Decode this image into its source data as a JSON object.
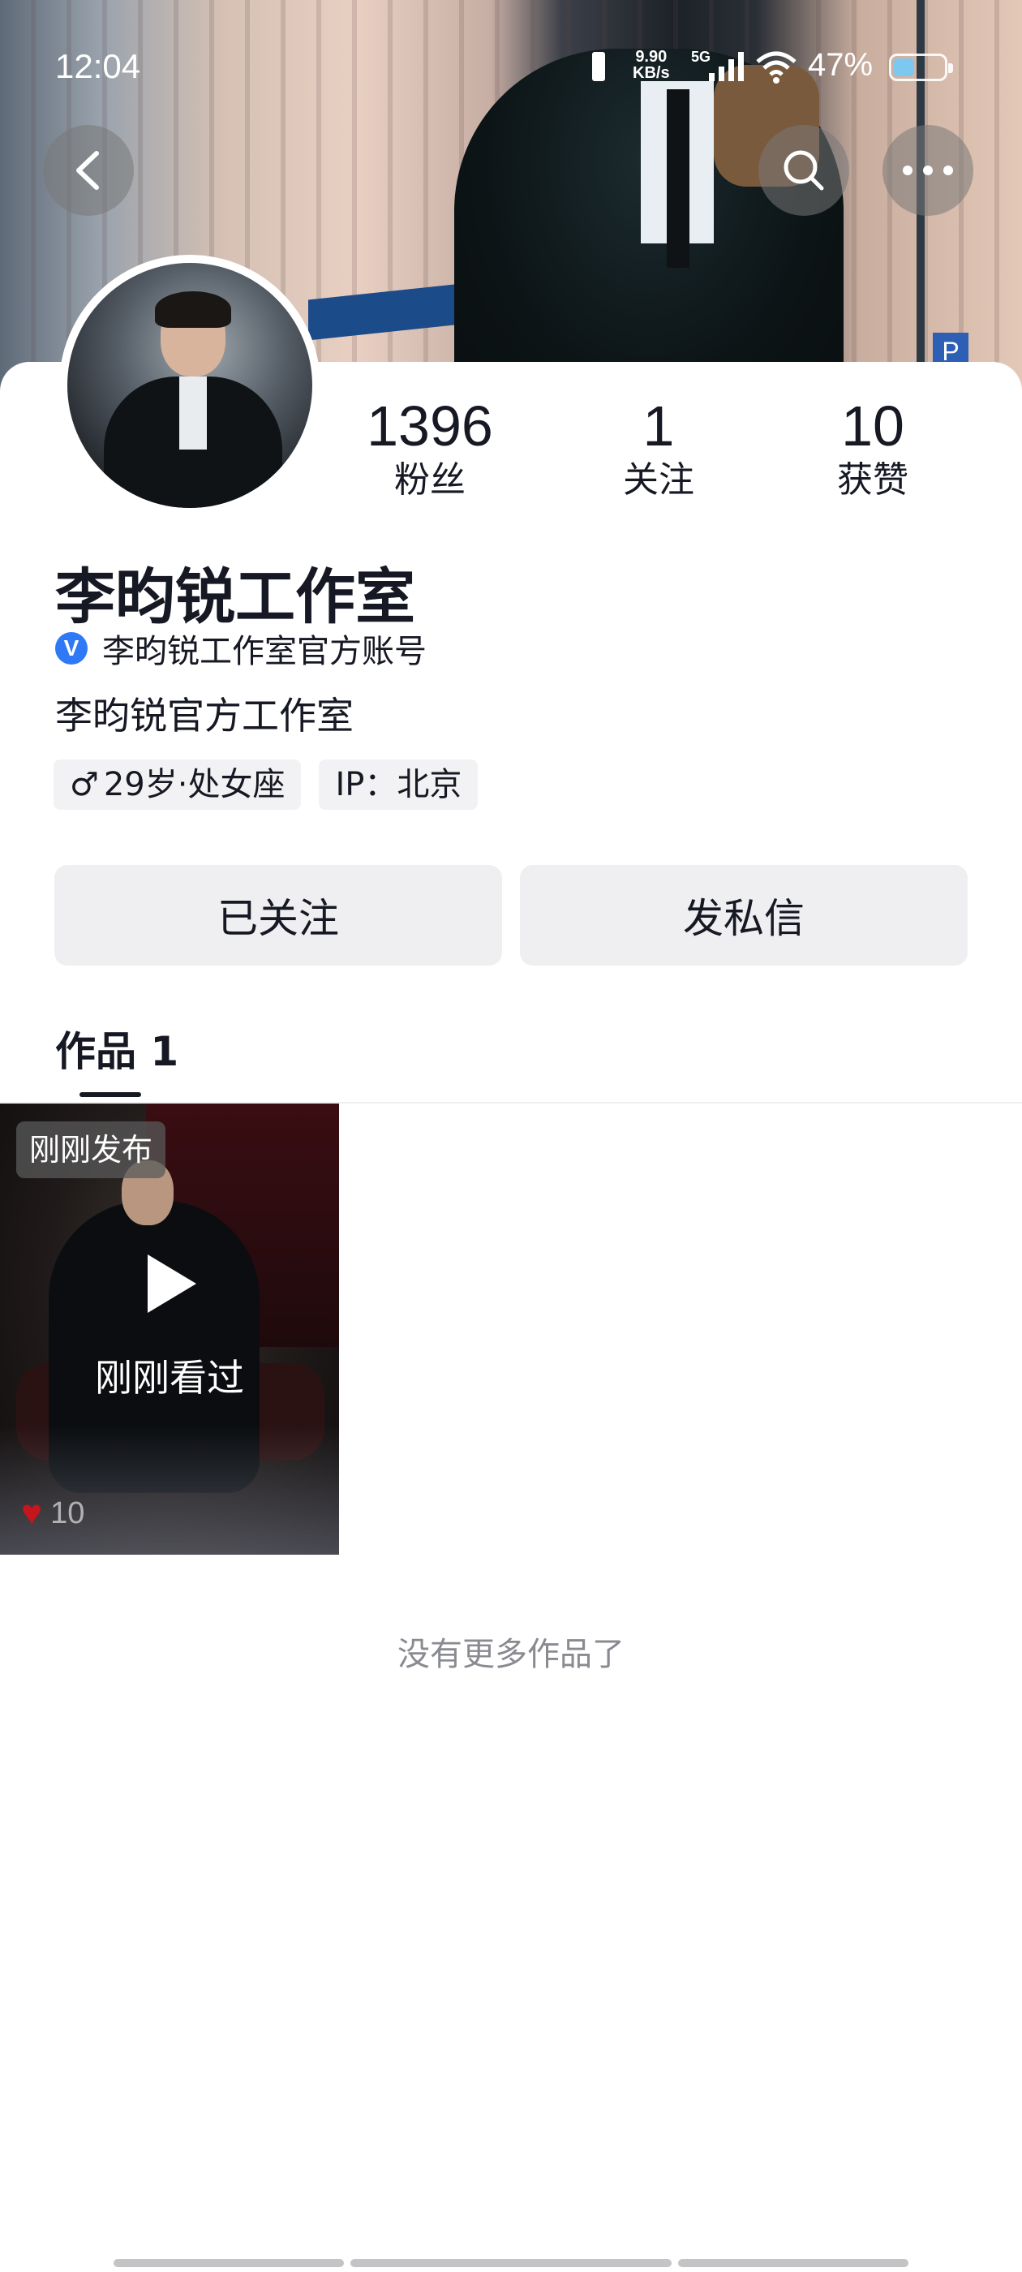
{
  "status_bar": {
    "time": "12:04",
    "net_speed_value": "9.90",
    "net_speed_unit": "KB/s",
    "network_type": "5G",
    "battery_percent": "47%",
    "battery_level": 0.47
  },
  "header": {
    "back_icon": "chevron-left-icon",
    "search_icon": "search-icon",
    "more_icon": "more-horizontal-icon"
  },
  "profile": {
    "stats": [
      {
        "value": "1396",
        "label": "粉丝"
      },
      {
        "value": "1",
        "label": "关注"
      },
      {
        "value": "10",
        "label": "获赞"
      }
    ],
    "name": "李昀锐工作室",
    "verified_text": "李昀锐工作室官方账号",
    "verified_badge": "V",
    "bio": "李昀锐官方工作室",
    "tags": {
      "gender_symbol": "♂",
      "age_sign": "29岁·处女座",
      "ip": "IP：北京"
    }
  },
  "actions": {
    "follow_label": "已关注",
    "message_label": "发私信"
  },
  "tabs": {
    "works_label": "作品 1"
  },
  "works": [
    {
      "badge": "刚刚发布",
      "overlay_text": "刚刚看过",
      "likes": "10"
    }
  ],
  "footer": {
    "no_more": "没有更多作品了"
  },
  "colors": {
    "verified_blue": "#2f79f6",
    "like_red": "#c4161c",
    "button_gray": "#efeff1",
    "text_primary": "#161823",
    "text_secondary": "#8a8b91"
  }
}
